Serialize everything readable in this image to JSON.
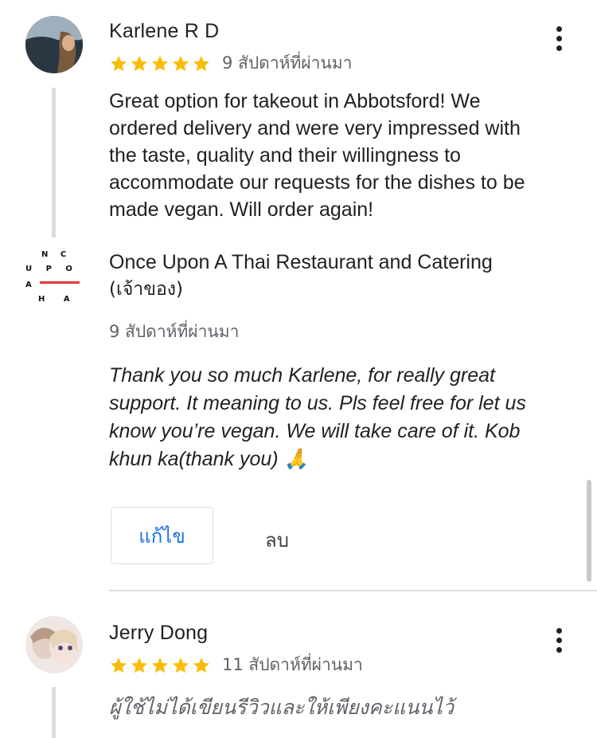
{
  "reviews": [
    {
      "author": "Karlene R D",
      "rating": 5,
      "time_ago": "9 สัปดาห์ที่ผ่านมา",
      "text": "Great option for takeout in Abbotsford! We ordered delivery and were very impressed with the taste, quality and their willingness to accommodate our requests for the dishes to be made vegan. Will order again!",
      "avatar_icon": "profile-photo-dark"
    },
    {
      "author": "Jerry Dong",
      "rating": 5,
      "time_ago": "11 สัปดาห์ที่ผ่านมา",
      "text": "ผู้ใช้ไม่ได้เขียนรีวิวและให้เพียงคะแนนไว้",
      "avatar_icon": "profile-photo-light"
    }
  ],
  "owner_reply": {
    "name_line1": "Once Upon A Thai Restaurant and Catering",
    "name_line2": "(เจ้าของ)",
    "time_ago": "9 สัปดาห์ที่ผ่านมา",
    "text": "Thank you so much Karlene, for really great support. It meaning to us. Pls feel free for let us know you’re vegan. We will take care of it. Kob khun ka(thank you) 🙏",
    "logo_letters": {
      "row1": "N C",
      "row2": "U P O N",
      "row3": "A",
      "row4": "H A"
    },
    "edit_label": "แก้ไข",
    "delete_label": "ลบ"
  },
  "colors": {
    "star": "#fbbc04",
    "accent": "#1a73e8",
    "logo_red": "#e53935"
  }
}
